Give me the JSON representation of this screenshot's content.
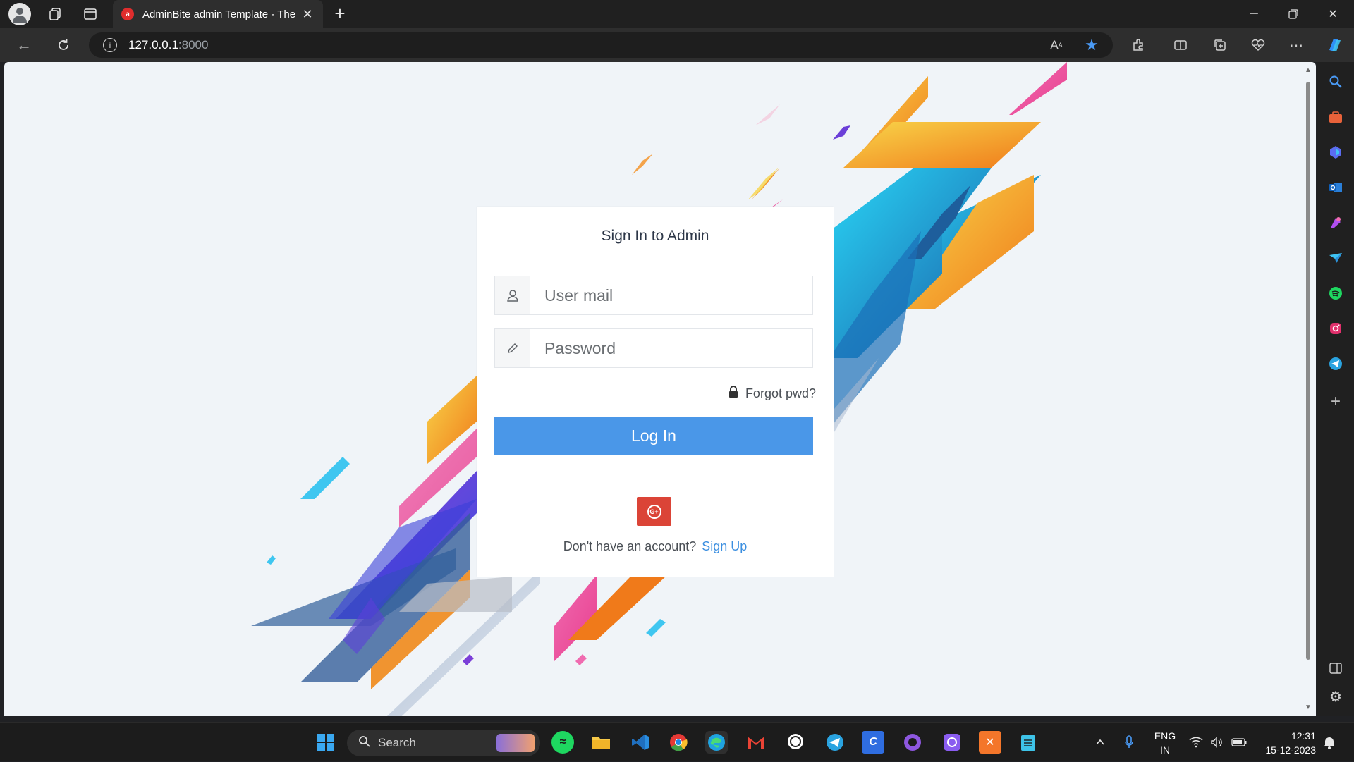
{
  "browser": {
    "tab_title": "AdminBite admin Template - The",
    "tab_favicon_letter": "a",
    "url_host": "127.0.0.1",
    "url_port": ":8000",
    "info_glyph": "i"
  },
  "login": {
    "title": "Sign In to Admin",
    "email_placeholder": "User mail",
    "password_placeholder": "Password",
    "forgot_label": "Forgot pwd?",
    "login_button": "Log In",
    "google_label": "G+",
    "no_account_text": "Don't have an account?",
    "signup_link": "Sign Up"
  },
  "taskbar": {
    "search_label": "Search",
    "language_line1": "ENG",
    "language_line2": "IN",
    "time": "12:31",
    "date": "15-12-2023"
  },
  "colors": {
    "login_button": "#4a97e8",
    "google_button": "#db4437",
    "page_background": "#f0f4f8",
    "link": "#3c8fe0"
  },
  "icons": {
    "sidebar": [
      "search-icon",
      "briefcase-icon",
      "copilot-icon",
      "outlook-icon",
      "designer-icon",
      "send-icon",
      "spotify-icon",
      "instagram-icon",
      "telegram-icon",
      "add-icon"
    ],
    "taskbar": [
      "windows-start-icon",
      "search-icon",
      "spotify-icon",
      "file-explorer-icon",
      "vscode-icon",
      "chrome-icon",
      "edge-icon",
      "gmail-icon",
      "whatsapp-icon",
      "telegram-icon",
      "canva-icon",
      "github-icon",
      "proton-icon",
      "xampp-icon",
      "notepad-icon"
    ]
  }
}
